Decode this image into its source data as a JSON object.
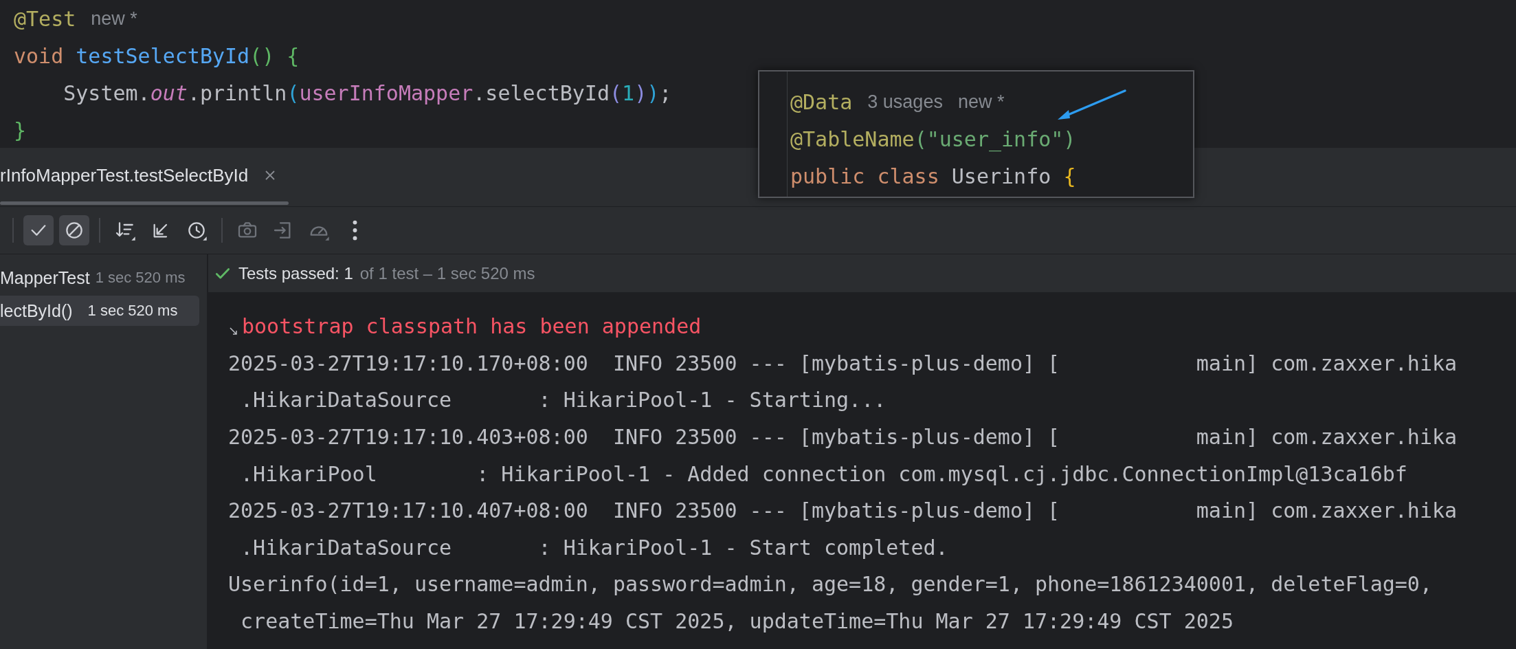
{
  "editor": {
    "lines": [
      {
        "tokens": [
          {
            "kind": "annotation",
            "text": "@Test"
          }
        ],
        "hints": [
          "new *"
        ]
      },
      {
        "tokens": [
          {
            "kind": "keyword",
            "text": "void "
          },
          {
            "kind": "method",
            "text": "testSelectById"
          },
          {
            "kind": "brace",
            "text": "() {"
          }
        ]
      },
      {
        "tokens": [
          {
            "kind": "plain",
            "text": "    System."
          },
          {
            "kind": "static",
            "text": "out"
          },
          {
            "kind": "plain",
            "text": ".println"
          },
          {
            "kind": "paren",
            "text": "("
          },
          {
            "kind": "field",
            "text": "userInfoMapper"
          },
          {
            "kind": "plain",
            "text": ".selectById"
          },
          {
            "kind": "paren2",
            "text": "("
          },
          {
            "kind": "number",
            "text": "1"
          },
          {
            "kind": "paren2",
            "text": ")"
          },
          {
            "kind": "paren",
            "text": ")"
          },
          {
            "kind": "plain",
            "text": ";"
          }
        ]
      },
      {
        "tokens": [
          {
            "kind": "brace",
            "text": "}"
          }
        ]
      }
    ]
  },
  "popup": {
    "lines": [
      {
        "tokens": [
          {
            "kind": "annotation",
            "text": "@Data"
          }
        ],
        "hints": [
          "3 usages",
          "new *"
        ]
      },
      {
        "tokens": [
          {
            "kind": "annotation",
            "text": "@TableName"
          },
          {
            "kind": "string",
            "text": "(\"user_info\")"
          }
        ]
      },
      {
        "tokens": [
          {
            "kind": "keyword",
            "text": "public class "
          },
          {
            "kind": "plain",
            "text": "Userinfo "
          },
          {
            "kind": "brace2",
            "text": "{"
          }
        ]
      }
    ]
  },
  "tab": {
    "label": "rInfoMapperTest.testSelectById"
  },
  "toolbar": [
    {
      "on": true,
      "disabled": false
    },
    {
      "on": true,
      "disabled": false
    },
    {
      "on": false,
      "disabled": false
    },
    {
      "on": false,
      "disabled": false
    },
    {
      "on": false,
      "disabled": false
    },
    {
      "on": false,
      "disabled": true
    },
    {
      "on": false,
      "disabled": true
    },
    {
      "on": false,
      "disabled": true
    },
    {
      "on": false,
      "disabled": false
    }
  ],
  "tree": [
    {
      "label": "MapperTest",
      "time": "1 sec 520 ms",
      "selected": false,
      "children": [
        {
          "label": "lectById()",
          "time": "1 sec 520 ms",
          "selected": true
        }
      ]
    }
  ],
  "status": {
    "passed": "Tests passed: 1",
    "detail": "of 1 test – 1 sec 520 ms"
  },
  "console": [
    {
      "kind": "error",
      "text": "bootstrap classpath has been appended"
    },
    {
      "kind": "log",
      "text": "2025-03-27T19:17:10.170+08:00  INFO 23500 --- [mybatis-plus-demo] [           main] com.zaxxer.hika"
    },
    {
      "kind": "log",
      "text": " .HikariDataSource       : HikariPool-1 - Starting..."
    },
    {
      "kind": "log",
      "text": "2025-03-27T19:17:10.403+08:00  INFO 23500 --- [mybatis-plus-demo] [           main] com.zaxxer.hika"
    },
    {
      "kind": "log",
      "text": " .HikariPool        : HikariPool-1 - Added connection com.mysql.cj.jdbc.ConnectionImpl@13ca16bf"
    },
    {
      "kind": "log",
      "text": "2025-03-27T19:17:10.407+08:00  INFO 23500 --- [mybatis-plus-demo] [           main] com.zaxxer.hika"
    },
    {
      "kind": "log",
      "text": " .HikariDataSource       : HikariPool-1 - Start completed."
    },
    {
      "kind": "log",
      "text": "Userinfo(id=1, username=admin, password=admin, age=18, gender=1, phone=18612340001, deleteFlag=0,"
    },
    {
      "kind": "log",
      "text": " createTime=Thu Mar 27 17:29:49 CST 2025, updateTime=Thu Mar 27 17:29:49 CST 2025"
    }
  ]
}
